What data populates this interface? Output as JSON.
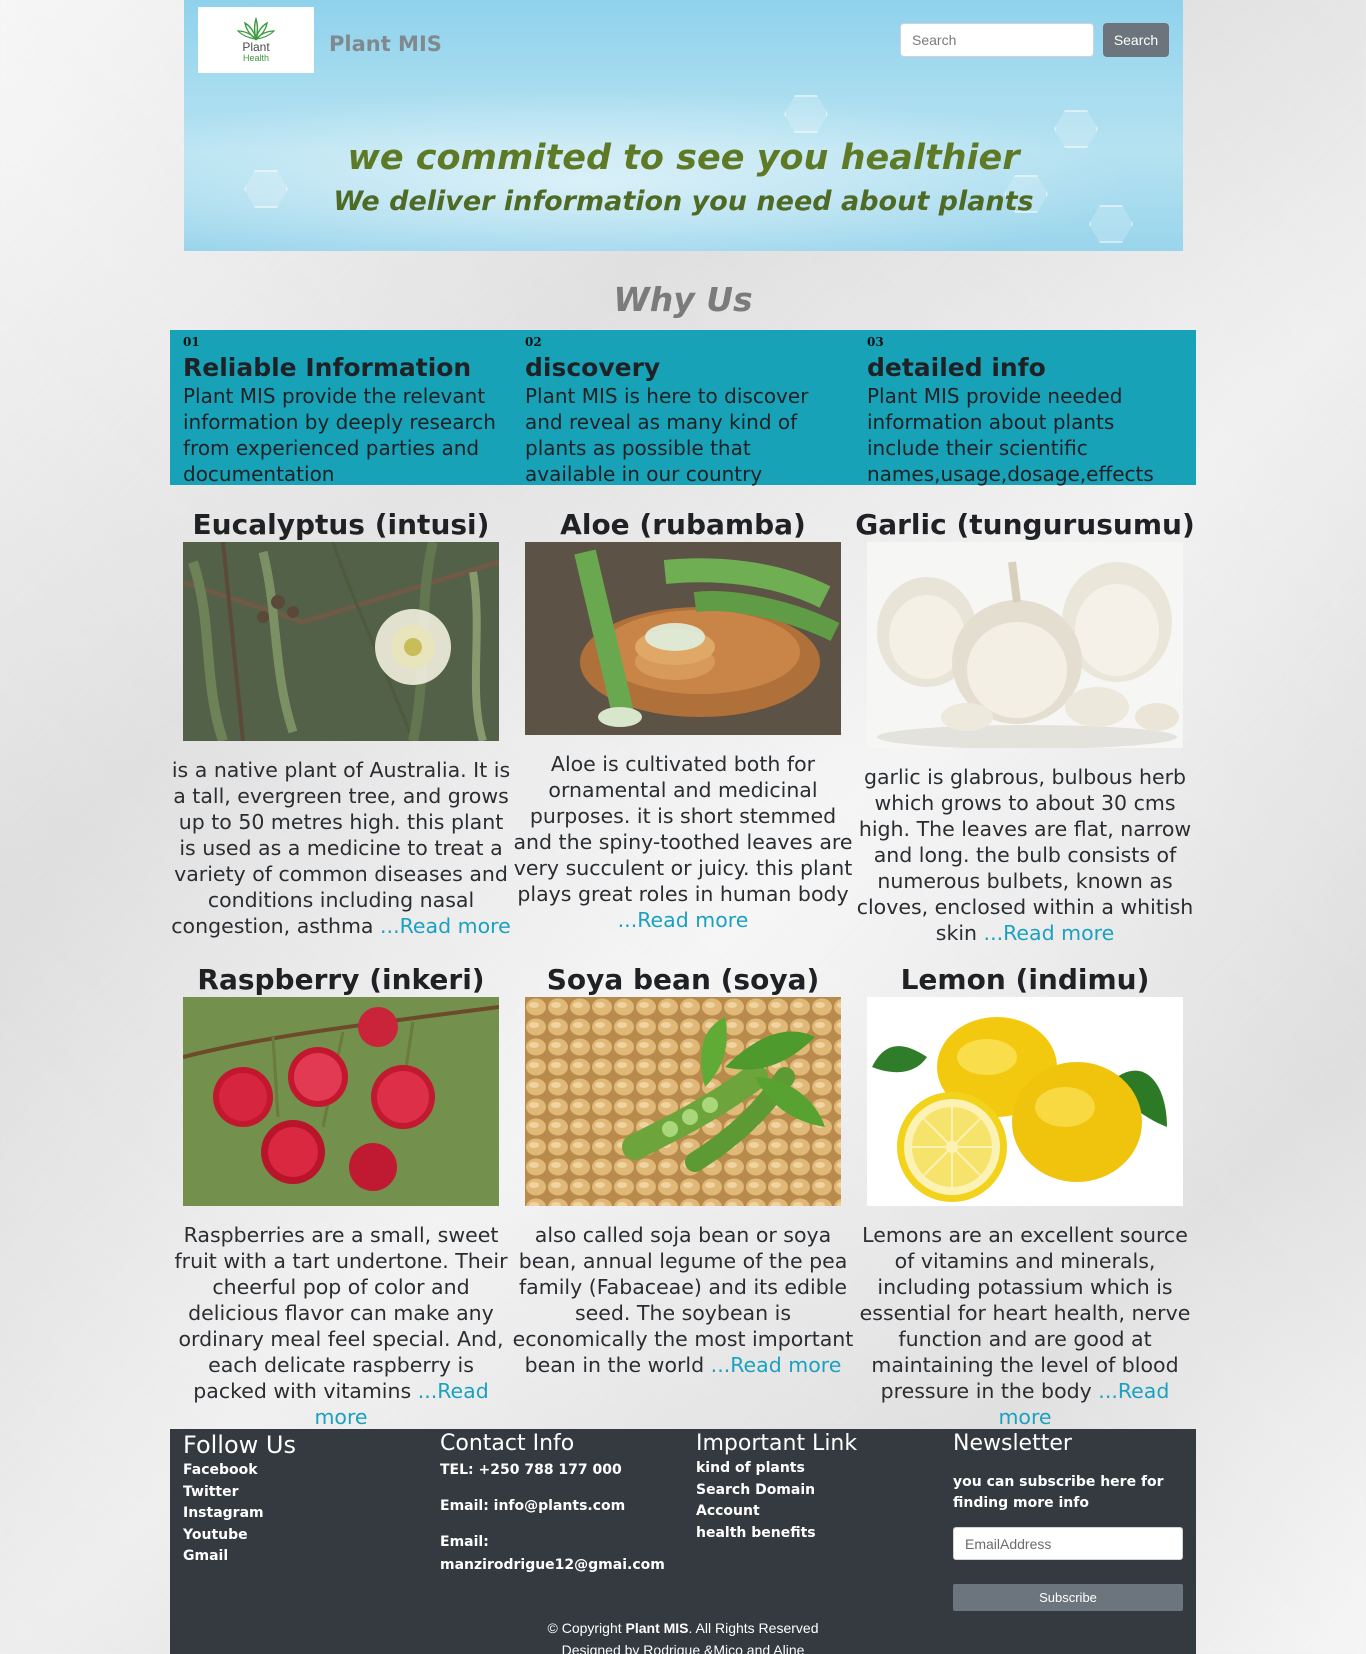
{
  "header": {
    "logo_line1": "Plant",
    "logo_line2": "Health",
    "brand": "Plant MIS",
    "search_placeholder": "Search",
    "search_button": "Search",
    "tagline1": "we commited to see you healthier",
    "tagline2": "We deliver information you need about plants"
  },
  "why": {
    "title": "Why Us",
    "items": [
      {
        "num": "01",
        "heading": "Reliable Information",
        "text": "Plant MIS provide the relevant information by deeply research from experienced parties and documentation"
      },
      {
        "num": "02",
        "heading": "discovery",
        "text": "Plant MIS is here to discover and reveal as many kind of plants as possible that available in our country"
      },
      {
        "num": "03",
        "heading": "detailed info",
        "text": "Plant MIS provide needed information about plants include their scientific names,usage,dosage,effects"
      }
    ]
  },
  "plants": [
    {
      "title": "Eucalyptus (intusi)",
      "desc": "is a native plant of Australia. It is a tall, evergreen tree, and grows up to 50 metres high. this plant is used as a medicine to treat a variety of common diseases and conditions including nasal congestion, asthma",
      "more": "...Read more"
    },
    {
      "title": "Aloe (rubamba)",
      "desc": "Aloe is cultivated both for ornamental and medicinal purposes. it is short stemmed and the spiny-toothed leaves are very succulent or juicy. this plant plays great roles in human body",
      "more": "...Read more"
    },
    {
      "title": "Garlic (tungurusumu)",
      "desc": "garlic is glabrous, bulbous herb which grows to about 30 cms high. The leaves are flat, narrow and long. the bulb consists of numerous bulbets, known as cloves, enclosed within a whitish skin",
      "more": "...Read more"
    },
    {
      "title": "Raspberry (inkeri)",
      "desc": "Raspberries are a small, sweet fruit with a tart undertone. Their cheerful pop of color and delicious flavor can make any ordinary meal feel special. And, each delicate raspberry is packed with vitamins",
      "more": "...Read more"
    },
    {
      "title": "Soya bean (soya)",
      "desc": "also called soja bean or soya bean, annual legume of the pea family (Fabaceae) and its edible seed. The soybean is economically the most important bean in the world",
      "more": "...Read more"
    },
    {
      "title": "Lemon (indimu)",
      "desc": "Lemons are an excellent source of vitamins and minerals, including potassium which is essential for heart health, nerve function and are good at maintaining the level of blood pressure in the body",
      "more": "...Read more"
    }
  ],
  "footer": {
    "follow": {
      "title": "Follow Us",
      "links": [
        "Facebook",
        "Twitter",
        "Instagram",
        "Youtube",
        "Gmail"
      ]
    },
    "contact": {
      "title": "Contact Info",
      "tel": "TEL: +250 788 177 000",
      "email1": "Email: info@plants.com",
      "email2_label": "Email:",
      "email2": "manzirodrigue12@gmai.com"
    },
    "important": {
      "title": "Important Link",
      "links": [
        "kind of plants",
        "Search Domain",
        "Account",
        "health benefits"
      ]
    },
    "newsletter": {
      "title": "Newsletter",
      "text": "you can subscribe here for finding more info",
      "placeholder": "EmailAddress",
      "button": "Subscribe"
    },
    "copyright_prefix": "© Copyright ",
    "copyright_brand": "Plant MIS",
    "copyright_suffix": ". All Rights Reserved",
    "designed": "Designed by Rodrigue &Mico and Aline"
  },
  "colors": {
    "teal": "#17a2b8",
    "dark": "#343a40",
    "olive": "#5e7a27",
    "link": "#1ba1c0"
  }
}
